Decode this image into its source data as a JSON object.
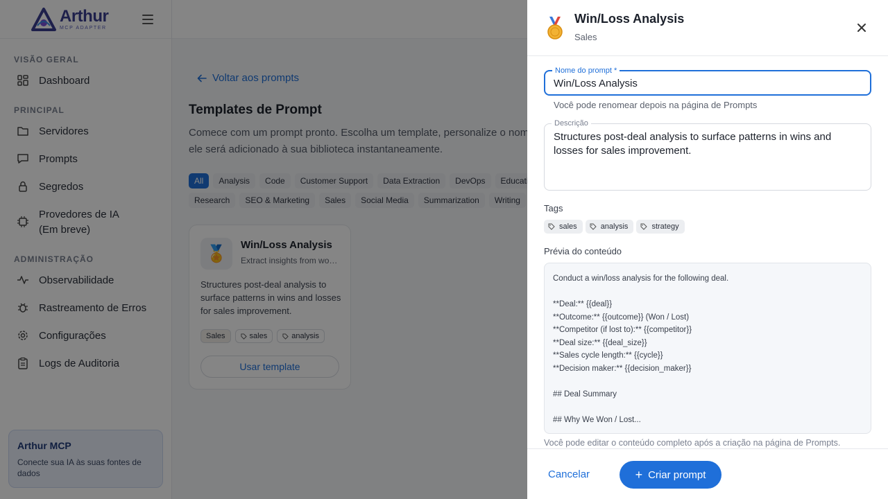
{
  "sidebar": {
    "logo": {
      "name": "Arthur",
      "subtitle": "MCP ADAPTER"
    },
    "sections": [
      {
        "title": "VISÃO GERAL",
        "items": [
          {
            "label": "Dashboard",
            "icon": "grid-icon"
          }
        ]
      },
      {
        "title": "PRINCIPAL",
        "items": [
          {
            "label": "Servidores",
            "icon": "folder-icon"
          },
          {
            "label": "Prompts",
            "icon": "chat-icon"
          },
          {
            "label": "Segredos",
            "icon": "lock-icon"
          },
          {
            "label": "Provedores de IA (Em breve)",
            "icon": "chip-icon"
          }
        ]
      },
      {
        "title": "ADMINISTRAÇÃO",
        "items": [
          {
            "label": "Observabilidade",
            "icon": "pulse-icon"
          },
          {
            "label": "Rastreamento de Erros",
            "icon": "bug-icon"
          },
          {
            "label": "Configurações",
            "icon": "gear-icon"
          },
          {
            "label": "Logs de Auditoria",
            "icon": "clipboard-icon"
          }
        ]
      }
    ],
    "promo": {
      "title": "Arthur MCP",
      "text": "Conecte sua IA às suas fontes de dados"
    }
  },
  "main": {
    "back_label": "Voltar aos prompts",
    "title": "Templates de Prompt",
    "subtitle": "Comece com um prompt pronto. Escolha um template, personalize o nome e ele será adicionado à sua biblioteca instantaneamente.",
    "filters_row1": [
      "All",
      "Analysis",
      "Code",
      "Customer Support",
      "Data Extraction",
      "DevOps",
      "Education"
    ],
    "filters_row2": [
      "Research",
      "SEO & Marketing",
      "Sales",
      "Social Media",
      "Summarization",
      "Writing"
    ],
    "card": {
      "title": "Win/Loss Analysis",
      "subtitle": "Extract insights from won and lost deals",
      "description": "Structures post-deal analysis to surface patterns in wins and losses for sales improvement.",
      "category": "Sales",
      "tags": [
        "sales",
        "analysis"
      ],
      "use_button": "Usar template"
    }
  },
  "drawer": {
    "title": "Win/Loss Analysis",
    "subtitle": "Sales",
    "name_label": "Nome do prompt *",
    "name_value": "Win/Loss Analysis",
    "name_helper": "Você pode renomear depois na página de Prompts",
    "desc_label": "Descrição",
    "desc_value": "Structures post-deal analysis to surface patterns in wins and losses for sales improvement.",
    "tags_label": "Tags",
    "tags": [
      "sales",
      "analysis",
      "strategy"
    ],
    "preview_label": "Prévia do conteúdo",
    "preview_lines": [
      "Conduct a win/loss analysis for the following deal.",
      "",
      "**Deal:** {{deal}}",
      "**Outcome:** {{outcome}} (Won / Lost)",
      "**Competitor (if lost to):** {{competitor}}",
      "**Deal size:** {{deal_size}}",
      "**Sales cycle length:** {{cycle}}",
      "**Decision maker:** {{decision_maker}}",
      "",
      "## Deal Summary",
      "",
      "## Why We Won / Lost..."
    ],
    "preview_note": "Você pode editar o conteúdo completo após a criação na página de Prompts.",
    "cancel_label": "Cancelar",
    "create_label": "Criar prompt"
  },
  "colors": {
    "accent": "#1f6fd9",
    "overlay": "rgba(0,0,0,0.48)"
  }
}
